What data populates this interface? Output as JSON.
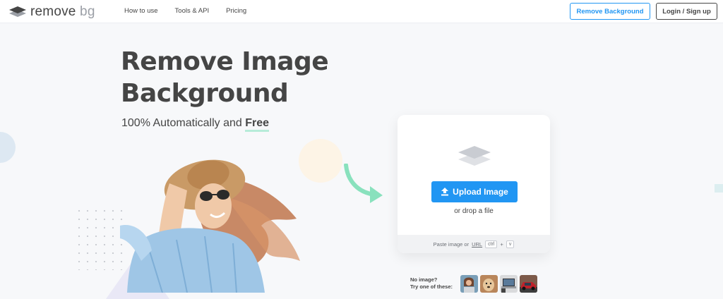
{
  "header": {
    "logo": {
      "word1": "remove",
      "word2": "bg"
    },
    "nav": [
      {
        "label": "How to use"
      },
      {
        "label": "Tools & API"
      },
      {
        "label": "Pricing"
      }
    ],
    "remove_bg_button": "Remove Background",
    "login_button": "Login / Sign up"
  },
  "hero": {
    "title_line1": "Remove Image",
    "title_line2": "Background",
    "subtitle_prefix": "100% Automatically and",
    "subtitle_free": "Free"
  },
  "upload_card": {
    "upload_button": "Upload Image",
    "drop_text": "or drop a file",
    "paste_prefix": "Paste image or",
    "paste_url": "URL",
    "key_ctrl": "ctrl",
    "key_plus": "+",
    "key_v": "v"
  },
  "samples": {
    "line1": "No image?",
    "line2": "Try one of these:",
    "items": [
      "sample-person",
      "sample-dog",
      "sample-laptop",
      "sample-car"
    ]
  },
  "colors": {
    "accent_blue": "#2196f3",
    "text_dark": "#454545",
    "free_underline": "#b7ecd9",
    "arrow_green": "#89e1bd"
  }
}
